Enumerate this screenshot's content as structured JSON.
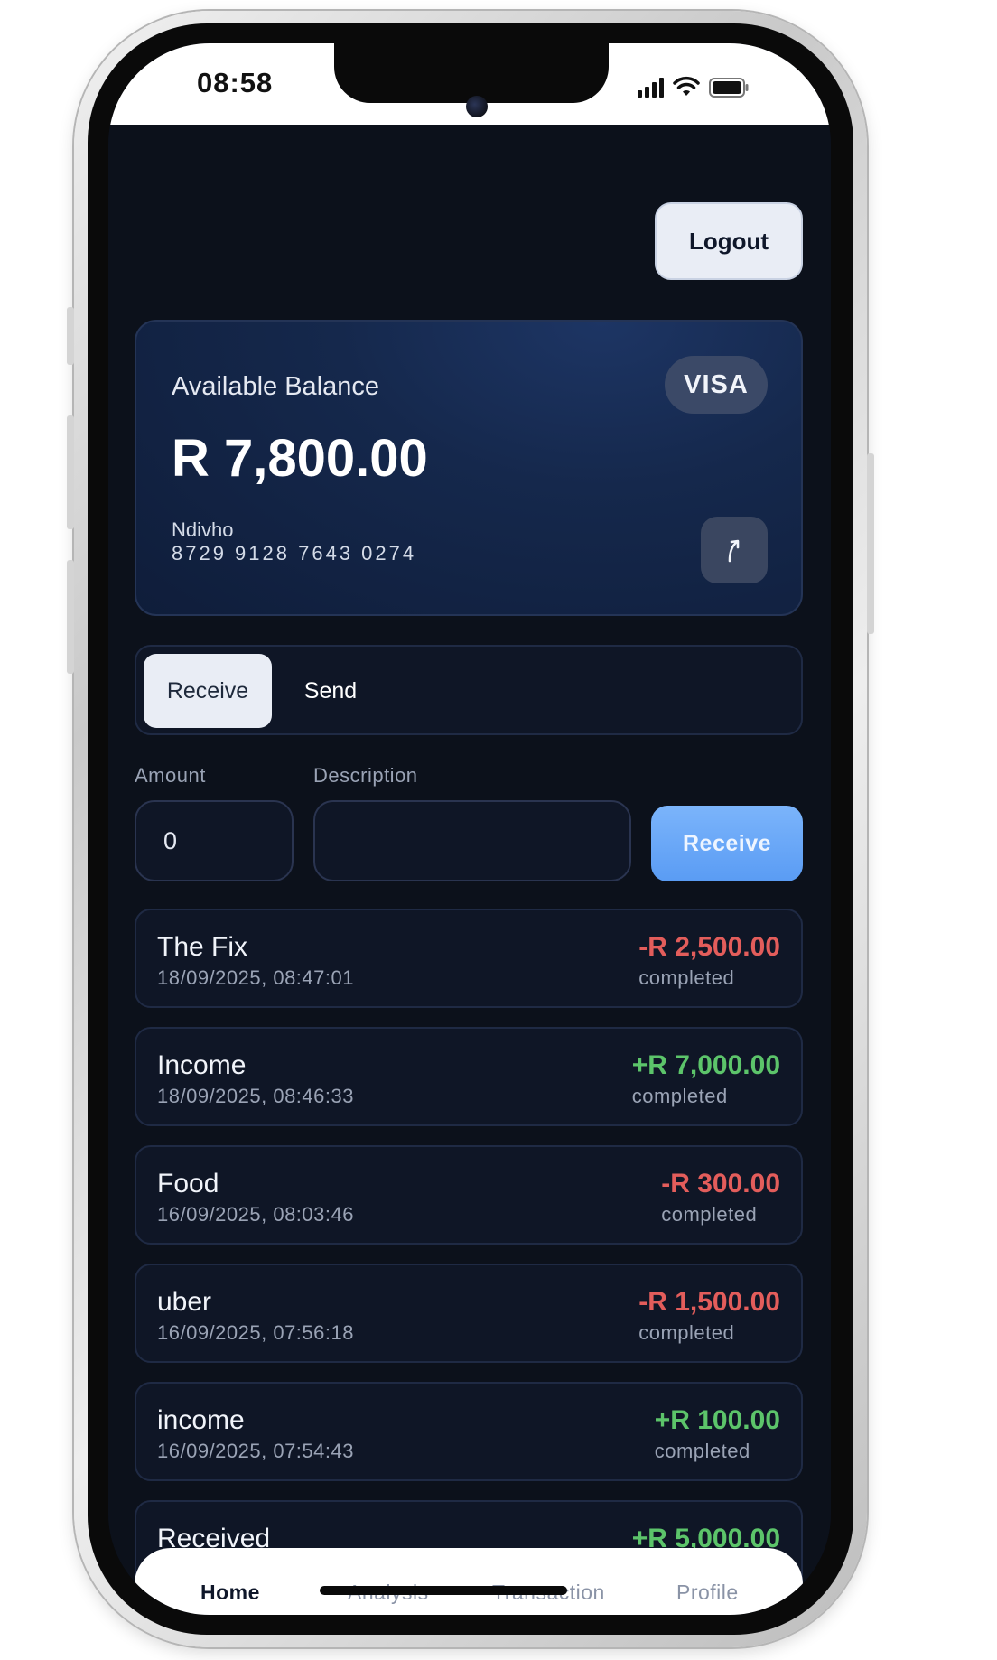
{
  "status_bar": {
    "time": "08:58"
  },
  "header": {
    "logout_label": "Logout"
  },
  "card": {
    "title": "Available Balance",
    "brand": "VISA",
    "balance": "R 7,800.00",
    "holder": "Ndivho",
    "number": "8729 9128 7643 0274",
    "share_icon": "arrow-up-right-icon"
  },
  "tabs": [
    {
      "label": "Receive",
      "active": true
    },
    {
      "label": "Send",
      "active": false
    }
  ],
  "form": {
    "amount_label": "Amount",
    "amount_value": "0",
    "description_label": "Description",
    "description_value": "",
    "submit_label": "Receive"
  },
  "transactions": [
    {
      "title": "The Fix",
      "date": "18/09/2025, 08:47:01",
      "amount": "-R 2,500.00",
      "status": "completed",
      "type": "debit"
    },
    {
      "title": "Income",
      "date": "18/09/2025, 08:46:33",
      "amount": "+R 7,000.00",
      "status": "completed",
      "type": "credit"
    },
    {
      "title": "Food",
      "date": "16/09/2025, 08:03:46",
      "amount": "-R 300.00",
      "status": "completed",
      "type": "debit"
    },
    {
      "title": "uber",
      "date": "16/09/2025, 07:56:18",
      "amount": "-R 1,500.00",
      "status": "completed",
      "type": "debit"
    },
    {
      "title": "income",
      "date": "16/09/2025, 07:54:43",
      "amount": "+R 100.00",
      "status": "completed",
      "type": "credit"
    },
    {
      "title": "Received",
      "date": "",
      "amount": "+R 5,000.00",
      "status": "",
      "type": "credit"
    }
  ],
  "bottom_nav": [
    {
      "label": "Home",
      "active": true
    },
    {
      "label": "Analysis",
      "active": false
    },
    {
      "label": "Transaction",
      "active": false
    },
    {
      "label": "Profile",
      "active": false
    }
  ],
  "colors": {
    "background": "#0c111b",
    "card": "#15284c",
    "accent": "#5a9cf4",
    "debit": "#e35d5b",
    "credit": "#5cc46a"
  }
}
